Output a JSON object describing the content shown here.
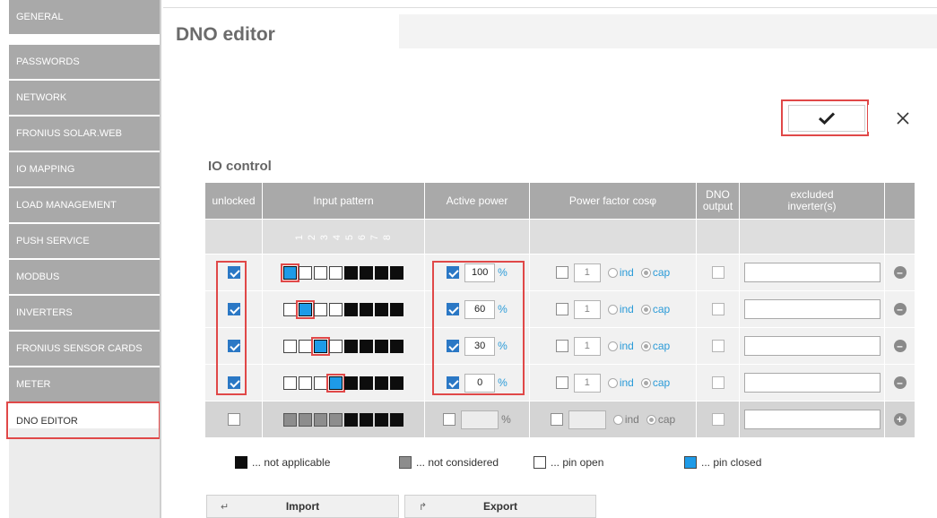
{
  "sidebar": {
    "items": [
      {
        "label": "GENERAL"
      },
      {
        "label": "PASSWORDS"
      },
      {
        "label": "NETWORK"
      },
      {
        "label": "FRONIUS SOLAR.WEB"
      },
      {
        "label": "IO MAPPING"
      },
      {
        "label": "LOAD MANAGEMENT"
      },
      {
        "label": "PUSH SERVICE"
      },
      {
        "label": "MODBUS"
      },
      {
        "label": "INVERTERS"
      },
      {
        "label": "FRONIUS SENSOR CARDS"
      },
      {
        "label": "METER"
      },
      {
        "label": "DNO EDITOR",
        "active": true
      }
    ]
  },
  "header": {
    "title": "DNO editor",
    "save_icon": "checkmark-icon",
    "cancel_icon": "close-icon"
  },
  "io_control": {
    "title": "IO control",
    "columns": {
      "unlocked": "unlocked",
      "input_pattern": "Input pattern",
      "active_power": "Active power",
      "power_factor": "Power factor cosφ",
      "dno_output_1": "DNO",
      "dno_output_2": "output",
      "excluded_1": "excluded",
      "excluded_2": "inverter(s)"
    },
    "pin_numbers": [
      "1",
      "2",
      "3",
      "4",
      "5",
      "6",
      "7",
      "8"
    ],
    "rows": [
      {
        "unlocked": true,
        "pattern": [
          "closed",
          "open",
          "open",
          "open",
          "na",
          "na",
          "na",
          "na"
        ],
        "ap_checked": true,
        "ap_value": "100",
        "ap_unit": "%",
        "pf_checked": false,
        "pf_value": "1",
        "ind_label": "ind",
        "cap_label": "cap",
        "cap_selected": true,
        "dno_output": false,
        "excluded": "",
        "action": "remove-icon"
      },
      {
        "unlocked": true,
        "pattern": [
          "open",
          "closed",
          "open",
          "open",
          "na",
          "na",
          "na",
          "na"
        ],
        "ap_checked": true,
        "ap_value": "60",
        "ap_unit": "%",
        "pf_checked": false,
        "pf_value": "1",
        "ind_label": "ind",
        "cap_label": "cap",
        "cap_selected": true,
        "dno_output": false,
        "excluded": "",
        "action": "remove-icon"
      },
      {
        "unlocked": true,
        "pattern": [
          "open",
          "open",
          "closed",
          "open",
          "na",
          "na",
          "na",
          "na"
        ],
        "ap_checked": true,
        "ap_value": "30",
        "ap_unit": "%",
        "pf_checked": false,
        "pf_value": "1",
        "ind_label": "ind",
        "cap_label": "cap",
        "cap_selected": true,
        "dno_output": false,
        "excluded": "",
        "action": "remove-icon"
      },
      {
        "unlocked": true,
        "pattern": [
          "open",
          "open",
          "open",
          "closed",
          "na",
          "na",
          "na",
          "na"
        ],
        "ap_checked": true,
        "ap_value": "0",
        "ap_unit": "%",
        "pf_checked": false,
        "pf_value": "1",
        "ind_label": "ind",
        "cap_label": "cap",
        "cap_selected": true,
        "dno_output": false,
        "excluded": "",
        "action": "remove-icon"
      }
    ],
    "new_row": {
      "pattern": [
        "nc",
        "nc",
        "nc",
        "nc",
        "na",
        "na",
        "na",
        "na"
      ],
      "ap_value": "",
      "ap_unit": "%",
      "pf_value": "",
      "ind_label": "ind",
      "cap_label": "cap",
      "action": "add-icon"
    }
  },
  "legend": {
    "not_applicable": "... not applicable",
    "not_considered": "... not considered",
    "pin_open": "... pin open",
    "pin_closed": "... pin closed"
  },
  "buttons": {
    "import": "Import",
    "export": "Export"
  },
  "colors": {
    "sidebar_bg": "#a9a9a9",
    "header_bg": "#a9a9a9",
    "accent": "#2b9bd8",
    "pin_closed": "#1e9be8",
    "highlight": "#e04848"
  }
}
